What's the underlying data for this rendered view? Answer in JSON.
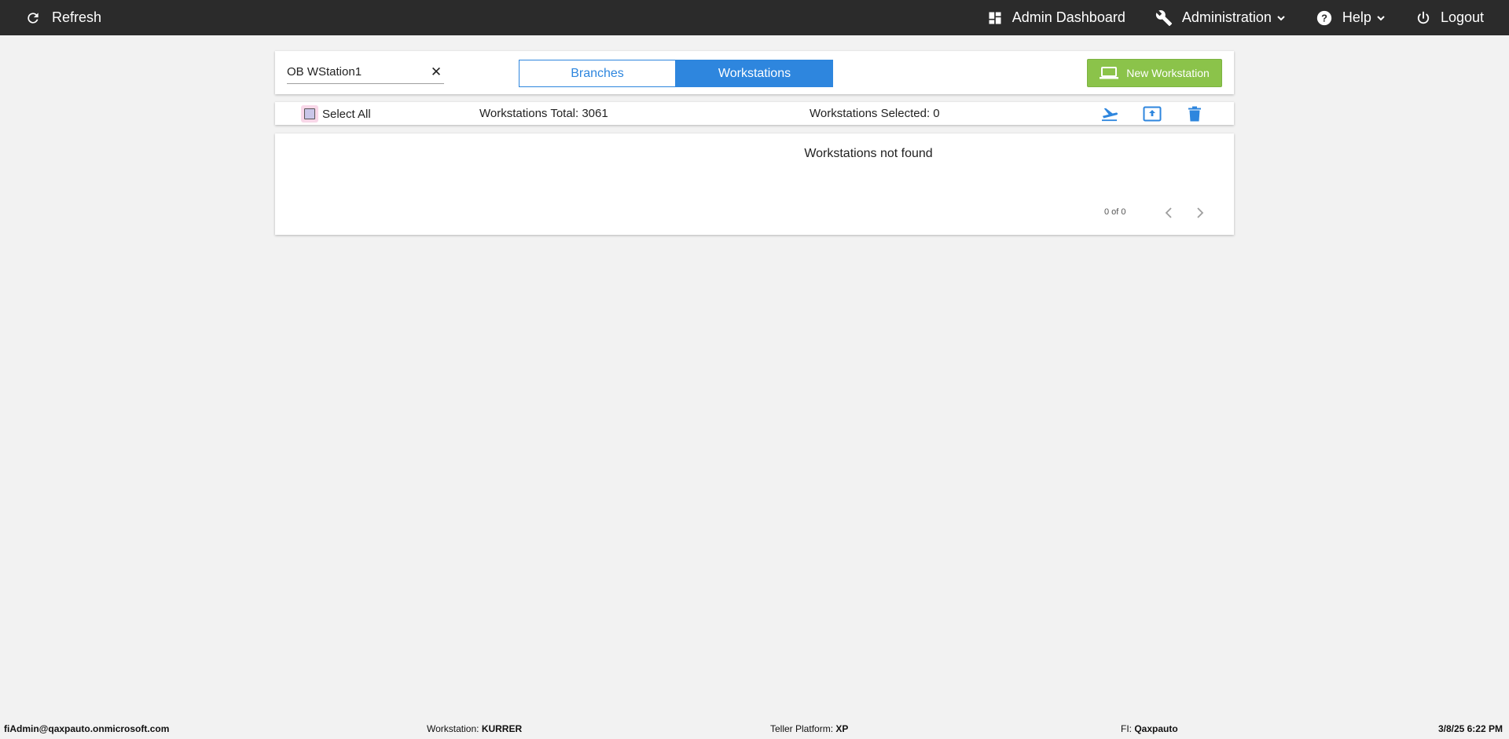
{
  "topbar": {
    "refresh_label": "Refresh",
    "admin_dashboard_label": "Admin Dashboard",
    "administration_label": "Administration",
    "help_label": "Help",
    "logout_label": "Logout",
    "background": "#2b2b2b"
  },
  "toolbar": {
    "search_value": "OB WStation1",
    "clear_symbol": "✕",
    "tabs": [
      {
        "label": "Branches",
        "active": false
      },
      {
        "label": "Workstations",
        "active": true
      }
    ],
    "new_button_label": "New Workstation",
    "accent_color": "#2e86de",
    "new_button_color": "#8bc34a"
  },
  "selection_bar": {
    "select_all_label": "Select All",
    "total_text": "Workstations Total: 3061",
    "selected_text": "Workstations Selected: 0",
    "actions": [
      "airplane-icon",
      "upload-icon",
      "trash-icon"
    ]
  },
  "results": {
    "empty_message": "Workstations not found",
    "pager_text": "0 of 0"
  },
  "footer": {
    "user": "fiAdmin@qaxpauto.onmicrosoft.com",
    "workstation_label": "Workstation: ",
    "workstation_value": "KURRER",
    "teller_platform_label": "Teller Platform: ",
    "teller_platform_value": "XP",
    "fi_label": "FI: ",
    "fi_value": "Qaxpauto",
    "datetime": "3/8/25 6:22 PM"
  }
}
